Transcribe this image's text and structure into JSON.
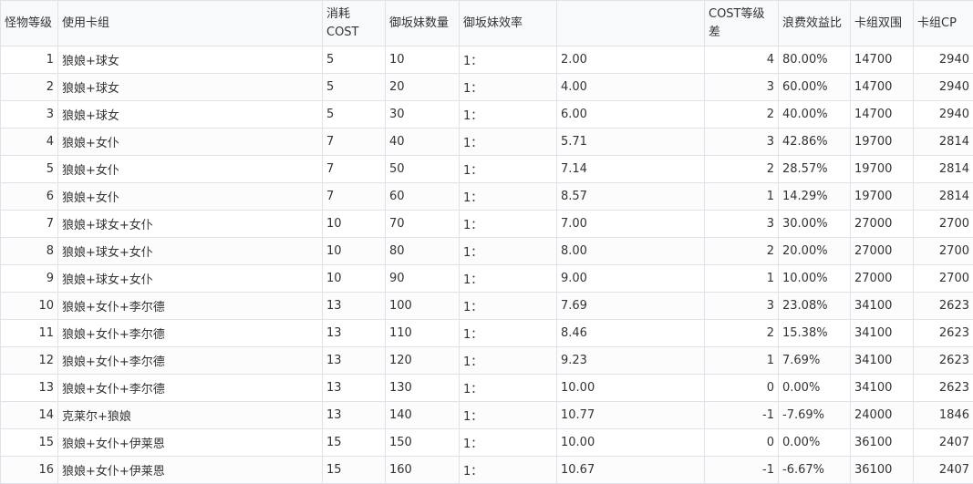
{
  "headers": [
    "怪物等级",
    "使用卡组",
    "消耗COST",
    "御坂妹数量",
    "御坂妹效率",
    "",
    "COST等级差",
    "浪费效益比",
    "卡组双围",
    "卡组CP"
  ],
  "rows": [
    {
      "level": "1",
      "deck": "狼娘+球女",
      "cost": "5",
      "count": "10",
      "ratio": "1：",
      "eff": "2.00",
      "diff": "4",
      "waste": "80.00%",
      "stats": "14700",
      "cp": "2940"
    },
    {
      "level": "2",
      "deck": "狼娘+球女",
      "cost": "5",
      "count": "20",
      "ratio": "1：",
      "eff": "4.00",
      "diff": "3",
      "waste": "60.00%",
      "stats": "14700",
      "cp": "2940"
    },
    {
      "level": "3",
      "deck": "狼娘+球女",
      "cost": "5",
      "count": "30",
      "ratio": "1：",
      "eff": "6.00",
      "diff": "2",
      "waste": "40.00%",
      "stats": "14700",
      "cp": "2940"
    },
    {
      "level": "4",
      "deck": "狼娘+女仆",
      "cost": "7",
      "count": "40",
      "ratio": "1：",
      "eff": "5.71",
      "diff": "3",
      "waste": "42.86%",
      "stats": "19700",
      "cp": "2814"
    },
    {
      "level": "5",
      "deck": "狼娘+女仆",
      "cost": "7",
      "count": "50",
      "ratio": "1：",
      "eff": "7.14",
      "diff": "2",
      "waste": "28.57%",
      "stats": "19700",
      "cp": "2814"
    },
    {
      "level": "6",
      "deck": "狼娘+女仆",
      "cost": "7",
      "count": "60",
      "ratio": "1：",
      "eff": "8.57",
      "diff": "1",
      "waste": "14.29%",
      "stats": "19700",
      "cp": "2814"
    },
    {
      "level": "7",
      "deck": "狼娘+球女+女仆",
      "cost": "10",
      "count": "70",
      "ratio": "1：",
      "eff": "7.00",
      "diff": "3",
      "waste": "30.00%",
      "stats": "27000",
      "cp": "2700"
    },
    {
      "level": "8",
      "deck": "狼娘+球女+女仆",
      "cost": "10",
      "count": "80",
      "ratio": "1：",
      "eff": "8.00",
      "diff": "2",
      "waste": "20.00%",
      "stats": "27000",
      "cp": "2700"
    },
    {
      "level": "9",
      "deck": "狼娘+球女+女仆",
      "cost": "10",
      "count": "90",
      "ratio": "1：",
      "eff": "9.00",
      "diff": "1",
      "waste": "10.00%",
      "stats": "27000",
      "cp": "2700"
    },
    {
      "level": "10",
      "deck": "狼娘+女仆+李尔德",
      "cost": "13",
      "count": "100",
      "ratio": "1：",
      "eff": "7.69",
      "diff": "3",
      "waste": "23.08%",
      "stats": "34100",
      "cp": "2623"
    },
    {
      "level": "11",
      "deck": "狼娘+女仆+李尔德",
      "cost": "13",
      "count": "110",
      "ratio": "1：",
      "eff": "8.46",
      "diff": "2",
      "waste": "15.38%",
      "stats": "34100",
      "cp": "2623"
    },
    {
      "level": "12",
      "deck": "狼娘+女仆+李尔德",
      "cost": "13",
      "count": "120",
      "ratio": "1：",
      "eff": "9.23",
      "diff": "1",
      "waste": "7.69%",
      "stats": "34100",
      "cp": "2623"
    },
    {
      "level": "13",
      "deck": "狼娘+女仆+李尔德",
      "cost": "13",
      "count": "130",
      "ratio": "1：",
      "eff": "10.00",
      "diff": "0",
      "waste": "0.00%",
      "stats": "34100",
      "cp": "2623"
    },
    {
      "level": "14",
      "deck": "克莱尔+狼娘",
      "cost": "13",
      "count": "140",
      "ratio": "1：",
      "eff": "10.77",
      "diff": "-1",
      "waste": "-7.69%",
      "stats": "24000",
      "cp": "1846"
    },
    {
      "level": "15",
      "deck": "狼娘+女仆+伊莱恩",
      "cost": "15",
      "count": "150",
      "ratio": "1：",
      "eff": "10.00",
      "diff": "0",
      "waste": "0.00%",
      "stats": "36100",
      "cp": "2407"
    },
    {
      "level": "16",
      "deck": "狼娘+女仆+伊莱恩",
      "cost": "15",
      "count": "160",
      "ratio": "1：",
      "eff": "10.67",
      "diff": "-1",
      "waste": "-6.67%",
      "stats": "36100",
      "cp": "2407"
    }
  ]
}
